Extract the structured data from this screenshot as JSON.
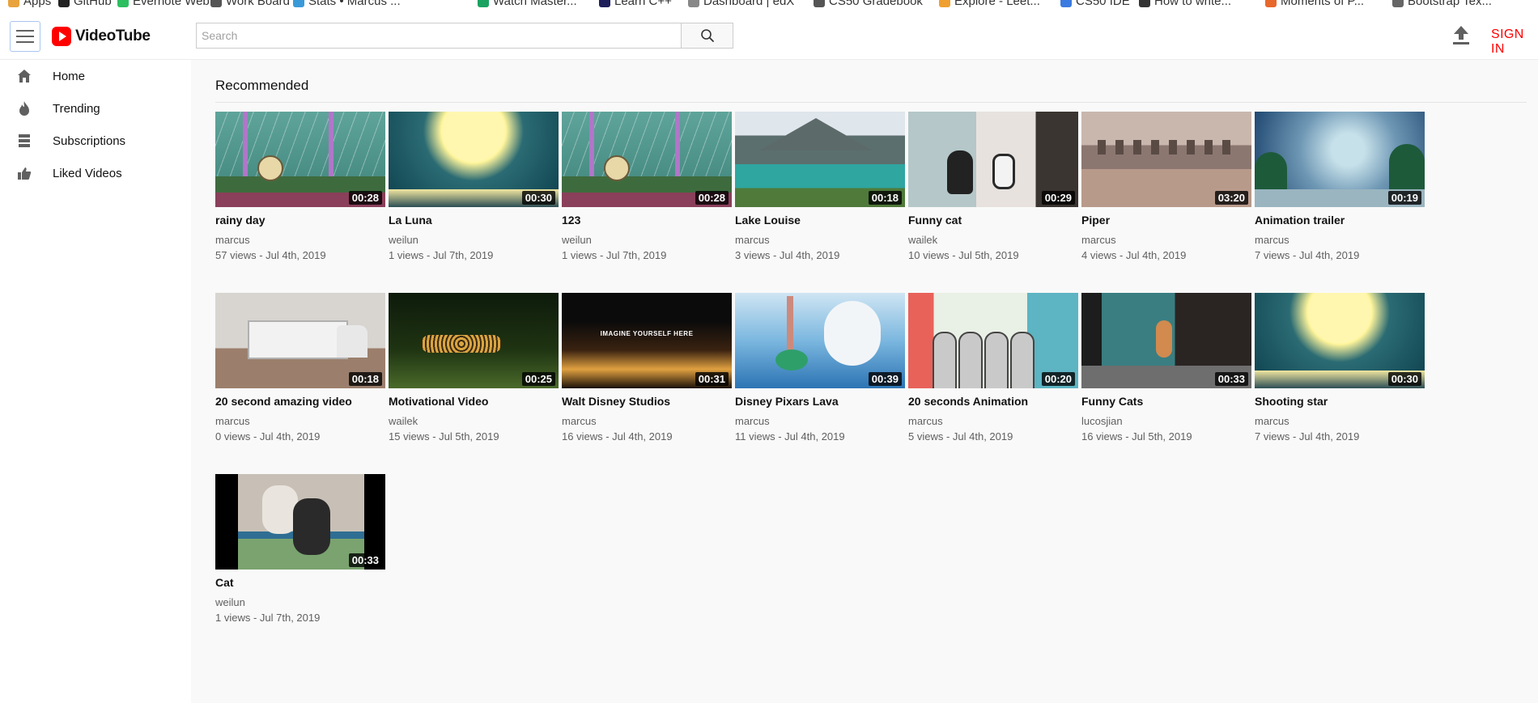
{
  "bookmarks": [
    {
      "label": "Apps",
      "color": "#e8a33d"
    },
    {
      "label": "GitHub",
      "color": "#222222"
    },
    {
      "label": "Evernote Web",
      "color": "#2dbe60"
    },
    {
      "label": "Work Board",
      "color": "#555555"
    },
    {
      "label": "Stats • Marcus ...",
      "color": "#3a9ad9"
    },
    {
      "label": "Watch Master...",
      "color": "#1aa260"
    },
    {
      "label": "Learn C++",
      "color": "#1d1d5a"
    },
    {
      "label": "Dashboard | edX",
      "color": "#888888"
    },
    {
      "label": "CS50 Gradebook",
      "color": "#555555"
    },
    {
      "label": "Explore - Leet...",
      "color": "#f0a030"
    },
    {
      "label": "CS50 IDE",
      "color": "#3b7ae0"
    },
    {
      "label": "How to write...",
      "color": "#333333"
    },
    {
      "label": "Moments of P...",
      "color": "#e8672b"
    },
    {
      "label": "Bootstrap Tex...",
      "color": "#666666"
    }
  ],
  "header": {
    "app_name": "VideoTube",
    "search_placeholder": "Search",
    "sign_in_label": "SIGN IN",
    "brand_color": "#ff0000"
  },
  "sidebar": {
    "items": [
      {
        "label": "Home",
        "icon": "home-icon"
      },
      {
        "label": "Trending",
        "icon": "fire-icon"
      },
      {
        "label": "Subscriptions",
        "icon": "subscriptions-icon"
      },
      {
        "label": "Liked Videos",
        "icon": "thumb-up-icon"
      }
    ]
  },
  "main": {
    "section_title": "Recommended",
    "videos": [
      {
        "title": "rainy day",
        "channel": "marcus",
        "meta": "57 views - Jul 4th, 2019",
        "duration": "00:28",
        "thumb": "rain"
      },
      {
        "title": "La Luna",
        "channel": "weilun",
        "meta": "1 views - Jul 7th, 2019",
        "duration": "00:30",
        "thumb": "moon"
      },
      {
        "title": "123",
        "channel": "weilun",
        "meta": "1 views - Jul 7th, 2019",
        "duration": "00:28",
        "thumb": "rain"
      },
      {
        "title": "Lake Louise",
        "channel": "marcus",
        "meta": "3 views - Jul 4th, 2019",
        "duration": "00:18",
        "thumb": "lake"
      },
      {
        "title": "Funny cat",
        "channel": "wailek",
        "meta": "10 views - Jul 5th, 2019",
        "duration": "00:29",
        "thumb": "cat1"
      },
      {
        "title": "Piper",
        "channel": "marcus",
        "meta": "4 views - Jul 4th, 2019",
        "duration": "03:20",
        "thumb": "piper"
      },
      {
        "title": "Animation trailer",
        "channel": "marcus",
        "meta": "7 views - Jul 4th, 2019",
        "duration": "00:19",
        "thumb": "anim"
      },
      {
        "title": "20 second amazing video",
        "channel": "marcus",
        "meta": "0 views - Jul 4th, 2019",
        "duration": "00:18",
        "thumb": "truck"
      },
      {
        "title": "Motivational Video",
        "channel": "wailek",
        "meta": "15 views - Jul 5th, 2019",
        "duration": "00:25",
        "thumb": "cheetah"
      },
      {
        "title": "Walt Disney Studios",
        "channel": "marcus",
        "meta": "16 views - Jul 4th, 2019",
        "duration": "00:31",
        "thumb": "disney"
      },
      {
        "title": "Disney Pixars Lava",
        "channel": "marcus",
        "meta": "11 views - Jul 4th, 2019",
        "duration": "00:39",
        "thumb": "lava"
      },
      {
        "title": "20 seconds Animation",
        "channel": "marcus",
        "meta": "5 views - Jul 4th, 2019",
        "duration": "00:20",
        "thumb": "cartoon"
      },
      {
        "title": "Funny Cats",
        "channel": "lucosjian",
        "meta": "16 views - Jul 5th, 2019",
        "duration": "00:33",
        "thumb": "cats2"
      },
      {
        "title": "Shooting star",
        "channel": "marcus",
        "meta": "7 views - Jul 4th, 2019",
        "duration": "00:30",
        "thumb": "moon"
      },
      {
        "title": "Cat",
        "channel": "weilun",
        "meta": "1 views - Jul 7th, 2019",
        "duration": "00:33",
        "thumb": "catlast"
      }
    ]
  },
  "thumb_text": {
    "disney": "IMAGINE YOURSELF HERE"
  }
}
